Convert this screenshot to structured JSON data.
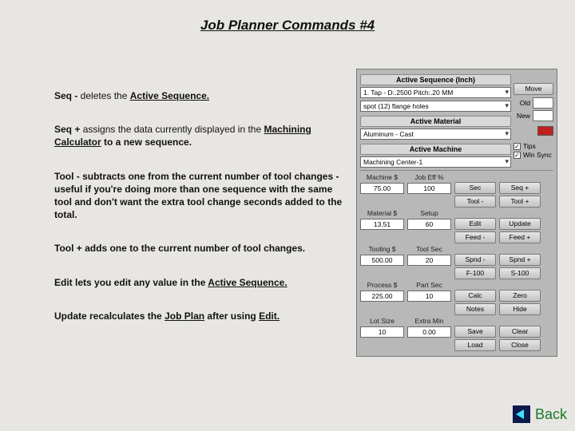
{
  "title": "Job Planner Commands #4",
  "paragraphs": {
    "p1a": "Seq -",
    "p1b": " deletes the ",
    "p1c": "Active Sequence.",
    "p2a": "Seq +",
    "p2b": " assigns the data currently displayed in the ",
    "p2c": "Machining Calculator",
    "p2d": " to a new sequence.",
    "p3a": "Tool -",
    "p3b": "  subtracts one from the current number of tool changes - useful if you're doing more than one sequence with the same tool and don't want the extra tool change seconds added to the total.",
    "p4a": "Tool +",
    "p4b": " adds one to the current number of tool changes.",
    "p5a": "Edit",
    "p5b": "  lets you edit any value in the ",
    "p5c": "Active Sequence.",
    "p6a": "Update",
    "p6b": " recalculates the ",
    "p6c": "Job Plan",
    "p6d": " after using ",
    "p6e": "Edit."
  },
  "panel": {
    "activeSeqHead": "Active Sequence (Inch)",
    "seqText": "1. Tap - D:.2500   Pitch:.20 MM",
    "moveBtn": "Move",
    "spotText": "spot (12) flange holes",
    "oldLbl": "Old",
    "oldVal": "",
    "newLbl": "New",
    "newVal": "",
    "activeMatHead": "Active Material",
    "matText": "Aluminum - Cast",
    "activeMachHead": "Active Machine",
    "machText": "Machining Center-1",
    "tipsChk": "Tips",
    "winSyncChk": "Win Sync",
    "swatchColor": "#c02020",
    "cols": [
      {
        "l": "Machine $",
        "v": "75.00"
      },
      {
        "l": "Job Eff %",
        "v": "100"
      },
      {
        "l": "Material $",
        "v": "13.51"
      },
      {
        "l": "Setup",
        "v": "60"
      },
      {
        "l": "Tooling $",
        "v": "500.00"
      },
      {
        "l": "Tool Sec",
        "v": "20"
      },
      {
        "l": "Process $",
        "v": "225.00"
      },
      {
        "l": "Part Sec",
        "v": "10"
      },
      {
        "l": "Lot Size",
        "v": "10"
      },
      {
        "l": "Extra Min",
        "v": "0.00"
      }
    ],
    "btns": [
      "Sec",
      "Seq +",
      "Tool -",
      "Tool +",
      "Edit",
      "Update",
      "Feed -",
      "Feed +",
      "Spnd -",
      "Spnd +",
      "F-100",
      "S-100",
      "Calc",
      "Zero",
      "Notes",
      "Hide",
      "Save",
      "Clear",
      "Load",
      "Close"
    ]
  },
  "back": "Back"
}
